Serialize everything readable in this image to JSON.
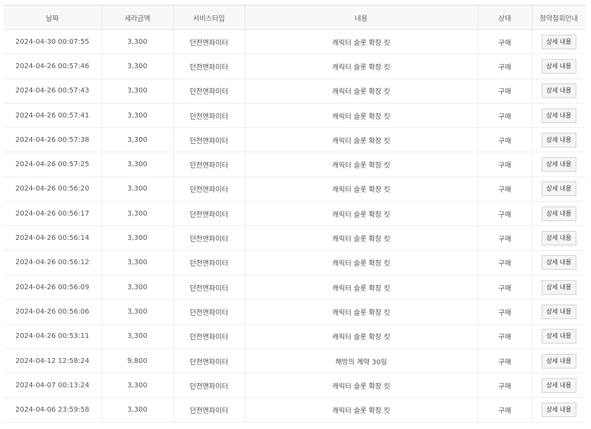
{
  "table": {
    "headers": [
      "날짜",
      "세라금액",
      "서비스타입",
      "내용",
      "상태",
      "청약철회안내"
    ],
    "rows": [
      {
        "date": "2024-04-30 00:07:55",
        "amount": "3,300",
        "service": "던전앤파이터",
        "content": "캐릭터 슬롯 확장 킷",
        "status": "구매",
        "action": "상세 내용"
      },
      {
        "date": "2024-04-26 00:57:46",
        "amount": "3,300",
        "service": "던전앤파이터",
        "content": "캐릭터 슬롯 확장 킷",
        "status": "구매",
        "action": "상세 내용"
      },
      {
        "date": "2024-04-26 00:57:43",
        "amount": "3,300",
        "service": "던전앤파이터",
        "content": "캐릭터 슬롯 확장 킷",
        "status": "구매",
        "action": "상세 내용"
      },
      {
        "date": "2024-04-26 00:57:41",
        "amount": "3,300",
        "service": "던전앤파이터",
        "content": "캐릭터 슬롯 확장 킷",
        "status": "구매",
        "action": "상세 내용"
      },
      {
        "date": "2024-04-26 00:57:38",
        "amount": "3,300",
        "service": "던전앤파이터",
        "content": "캐릭터 슬롯 확장 킷",
        "status": "구매",
        "action": "상세 내용"
      },
      {
        "date": "2024-04-26 00:57:25",
        "amount": "3,300",
        "service": "던전앤파이터",
        "content": "캐릭터 슬롯 확장 킷",
        "status": "구매",
        "action": "상세 내용"
      },
      {
        "date": "2024-04-26 00:56:20",
        "amount": "3,300",
        "service": "던전앤파이터",
        "content": "캐릭터 슬롯 확장 킷",
        "status": "구매",
        "action": "상세 내용"
      },
      {
        "date": "2024-04-26 00:56:17",
        "amount": "3,300",
        "service": "던전앤파이터",
        "content": "캐릭터 슬롯 확장 킷",
        "status": "구매",
        "action": "상세 내용"
      },
      {
        "date": "2024-04-26 00:56:14",
        "amount": "3,300",
        "service": "던전앤파이터",
        "content": "캐릭터 슬롯 확장 킷",
        "status": "구매",
        "action": "상세 내용"
      },
      {
        "date": "2024-04-26 00:56:12",
        "amount": "3,300",
        "service": "던전앤파이터",
        "content": "캐릭터 슬롯 확장 킷",
        "status": "구매",
        "action": "상세 내용"
      },
      {
        "date": "2024-04-26 00:56:09",
        "amount": "3,300",
        "service": "던전앤파이터",
        "content": "캐릭터 슬롯 확장 킷",
        "status": "구매",
        "action": "상세 내용"
      },
      {
        "date": "2024-04-26 00:56:06",
        "amount": "3,300",
        "service": "던전앤파이터",
        "content": "캐릭터 슬롯 확장 킷",
        "status": "구매",
        "action": "상세 내용"
      },
      {
        "date": "2024-04-26 00:53:11",
        "amount": "3,300",
        "service": "던전앤파이터",
        "content": "캐릭터 슬롯 확장 킷",
        "status": "구매",
        "action": "상세 내용"
      },
      {
        "date": "2024-04-12 12:58:24",
        "amount": "9,800",
        "service": "던전앤파이터",
        "content": "해방의 계약 30일",
        "status": "구매",
        "action": "상세 내용"
      },
      {
        "date": "2024-04-07 00:13:24",
        "amount": "3,300",
        "service": "던전앤파이터",
        "content": "캐릭터 슬롯 확장 킷",
        "status": "구매",
        "action": "상세 내용"
      },
      {
        "date": "2024-04-06 23:59:58",
        "amount": "3,300",
        "service": "던전앤파이터",
        "content": "캐릭터 슬롯 확장 킷",
        "status": "구매",
        "action": "상세 내용"
      }
    ]
  }
}
